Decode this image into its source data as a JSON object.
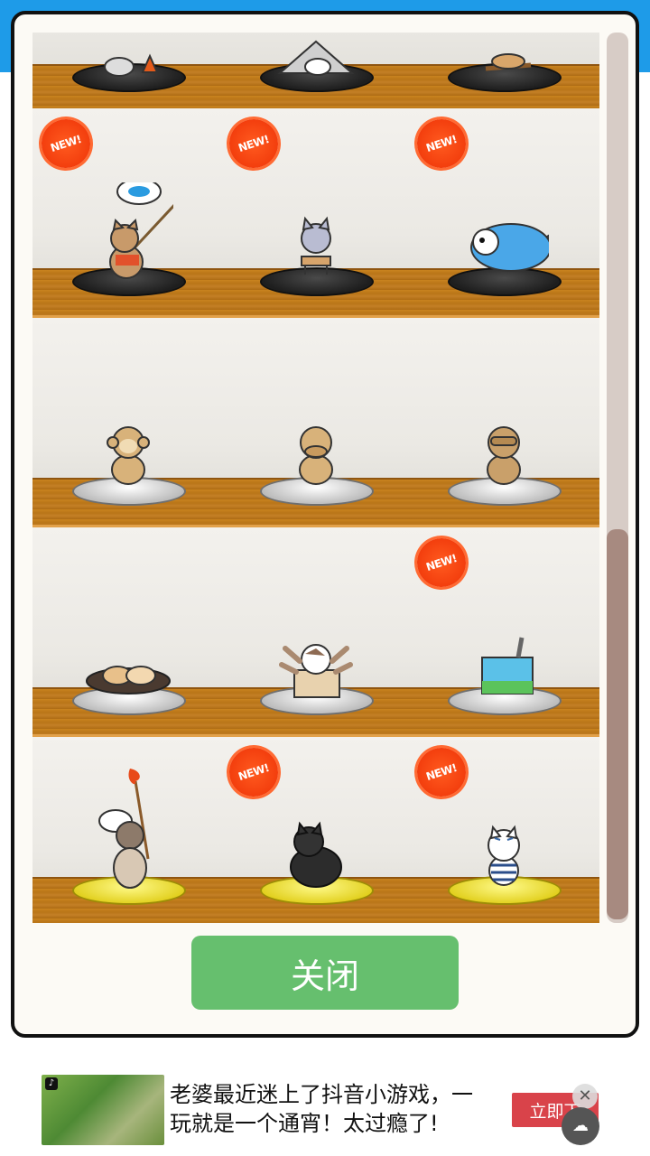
{
  "badge": {
    "new_label": "NEW!"
  },
  "close_button_label": "关闭",
  "rows": [
    {
      "pedestal": "dark",
      "cats": [
        {
          "name": "cat-with-campfire",
          "new": false
        },
        {
          "name": "cat-in-tent",
          "new": false
        },
        {
          "name": "cat-on-sled",
          "new": false
        }
      ]
    },
    {
      "pedestal": "dark",
      "cats": [
        {
          "name": "fishing-cat",
          "new": true
        },
        {
          "name": "cat-at-small-table",
          "new": true
        },
        {
          "name": "cat-in-fish-costume",
          "new": true
        }
      ]
    },
    {
      "pedestal": "silver",
      "cats": [
        {
          "name": "monkey-hear-no-evil",
          "new": false
        },
        {
          "name": "monkey-speak-no-evil",
          "new": false
        },
        {
          "name": "monkey-see-no-evil",
          "new": false
        }
      ]
    },
    {
      "pedestal": "silver",
      "cats": [
        {
          "name": "cats-in-pan",
          "new": false
        },
        {
          "name": "cat-in-box-many-paws",
          "new": false
        },
        {
          "name": "cat-in-milk-carton",
          "new": true
        }
      ]
    },
    {
      "pedestal": "gold",
      "cats": [
        {
          "name": "chef-cat-with-torch",
          "new": false
        },
        {
          "name": "black-cat-pair",
          "new": true
        },
        {
          "name": "sailor-cat",
          "new": true
        }
      ]
    }
  ],
  "ad": {
    "text": "老婆最近迷上了抖音小游戏，一玩就是一个通宵！太过瘾了!",
    "cta_label": "立即下",
    "close_glyph": "✕",
    "app_icon_glyph": "♪"
  },
  "colors": {
    "header_blue": "#1e9be8",
    "button_green": "#66bf6e",
    "badge_orange": "#f23c0c",
    "ad_red": "#d9434a"
  }
}
